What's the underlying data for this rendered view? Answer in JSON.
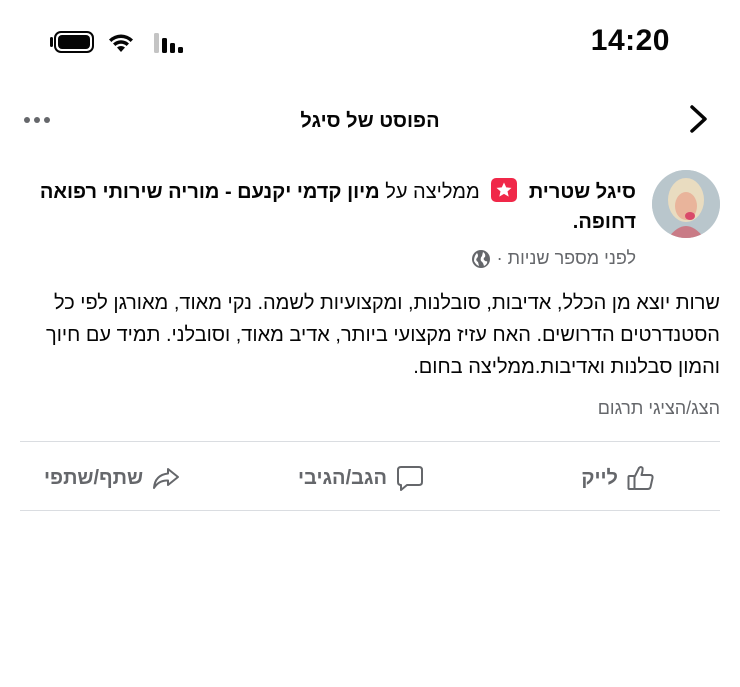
{
  "status_bar": {
    "time": "14:20"
  },
  "nav": {
    "title": "הפוסט של סיגל"
  },
  "post": {
    "author": "סיגל שטרית",
    "recommends_text": "ממליצה על",
    "page_name": "מיון קדמי יקנעם - מוריה שירותי רפואה דחופה.",
    "timestamp": "לפני מספר שניות ·",
    "body": "שרות יוצא מן הכלל, אדיבות, סובלנות, ומקצועיות לשמה. נקי מאוד, מאורגן לפי כל הסטנדרטים הדרושים. האח עזיז מקצועי ביותר, אדיב מאוד, וסובלני. תמיד עם חיוך והמון סבלנות ואדיבות.ממליצה בחום.",
    "translate_label": "הצג/הציגי תרגום"
  },
  "actions": {
    "like": "לייק",
    "comment": "הגב/הגיבי",
    "share": "שתף/שתפי"
  },
  "colors": {
    "recommend_badge": "#f02849",
    "secondary_text": "#65676b",
    "divider": "#dadde1"
  }
}
